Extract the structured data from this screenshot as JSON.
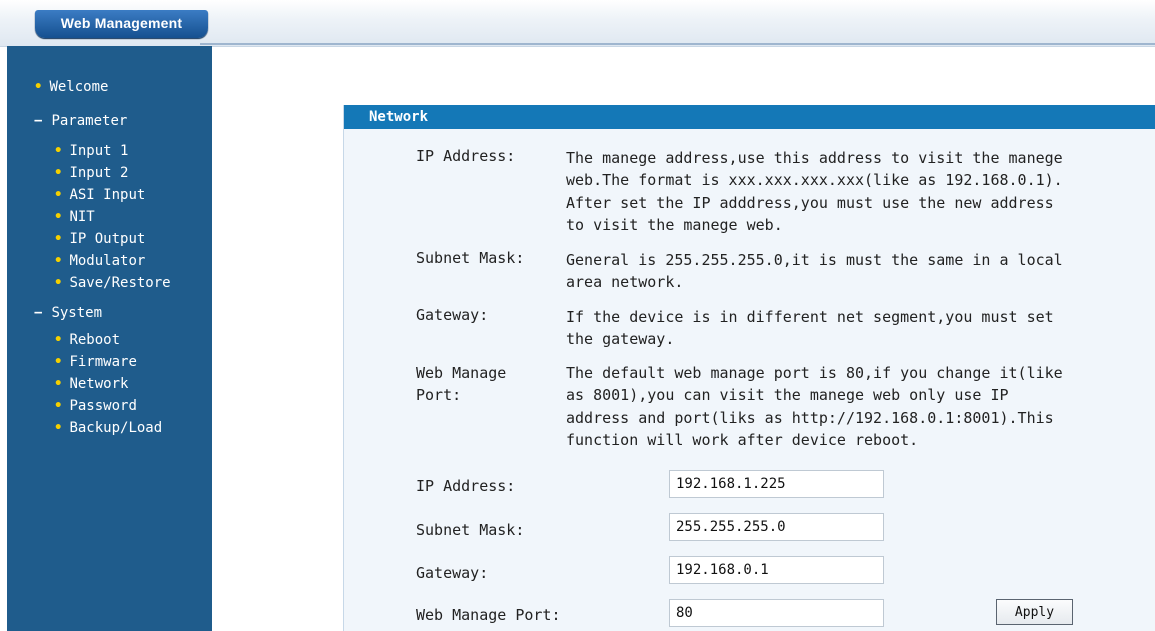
{
  "header": {
    "brand": "Web Management"
  },
  "sidebar": {
    "welcome": "Welcome",
    "parameter": {
      "label": "Parameter",
      "items": [
        "Input 1",
        "Input 2",
        "ASI Input",
        "NIT",
        "IP Output",
        "Modulator",
        "Save/Restore"
      ]
    },
    "system": {
      "label": "System",
      "items": [
        "Reboot",
        "Firmware",
        "Network",
        "Password",
        "Backup/Load"
      ]
    }
  },
  "panel": {
    "title": "Network",
    "help": [
      {
        "label": "IP Address:",
        "lines": [
          "The manege address,use this address to visit the manege",
          "web.The format is xxx.xxx.xxx.xxx(like as 192.168.0.1).",
          "After set the IP adddress,you must use the new address",
          "to visit the manege web."
        ]
      },
      {
        "label": "Subnet Mask:",
        "lines": [
          "General is 255.255.255.0,it is must the same in a local",
          "area network."
        ]
      },
      {
        "label": "Gateway:",
        "lines": [
          "If the device is in different net segment,you must set",
          "the gateway."
        ]
      },
      {
        "label_lines": [
          "Web Manage",
          "Port:"
        ],
        "lines": [
          "The default web manage port is 80,if you change it(like",
          "as 8001),you can visit the manege web only use IP",
          "address and port(liks as http://192.168.0.1:8001).This",
          "function will work after device reboot."
        ]
      }
    ],
    "form": {
      "ip": {
        "label": "IP Address:",
        "value": "192.168.1.225"
      },
      "mask": {
        "label": "Subnet Mask:",
        "value": "255.255.255.0"
      },
      "gateway": {
        "label": "Gateway:",
        "value": "192.168.0.1"
      },
      "port": {
        "label": "Web Manage Port:",
        "value": "80"
      },
      "apply_label": "Apply"
    }
  },
  "colors": {
    "sidebar_bg": "#1f5c8c",
    "header_bar": "#1478b7",
    "bullet": "#f4d000",
    "panel_bg": "#f1f6fb"
  }
}
